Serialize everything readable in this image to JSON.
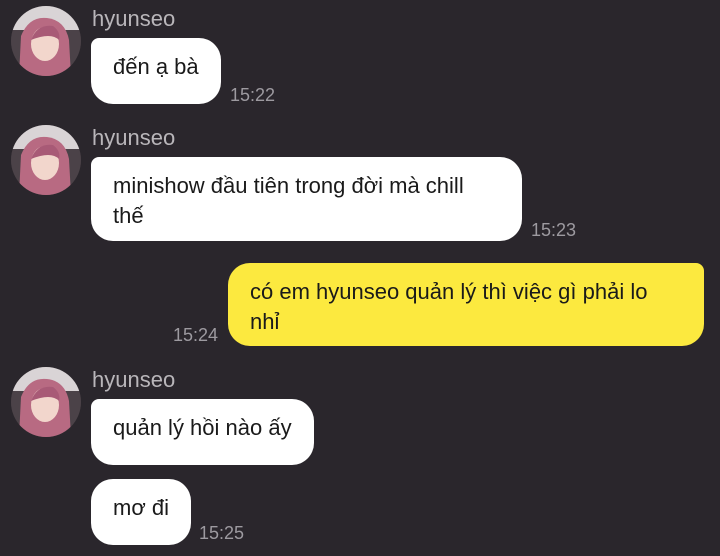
{
  "messages": [
    {
      "sender": "hyunseo",
      "bubbles": [
        "đến ạ bà"
      ],
      "time": "15:22"
    },
    {
      "sender": "hyunseo",
      "bubbles": [
        "minishow đầu tiên trong đời mà chill thế"
      ],
      "time": "15:23"
    },
    {
      "sender": "",
      "bubbles": [
        "có em hyunseo quản lý thì việc gì phải lo nhỉ"
      ],
      "time": "15:24"
    },
    {
      "sender": "hyunseo",
      "bubbles": [
        "quản lý hồi nào ấy",
        "mơ đi"
      ],
      "time": "15:25"
    }
  ],
  "colors": {
    "background": "#2a262c",
    "incoming_bubble": "#ffffff",
    "outgoing_bubble": "#fce93f",
    "sender_text": "#b9b6ba",
    "time_text": "#9d9aa0"
  }
}
